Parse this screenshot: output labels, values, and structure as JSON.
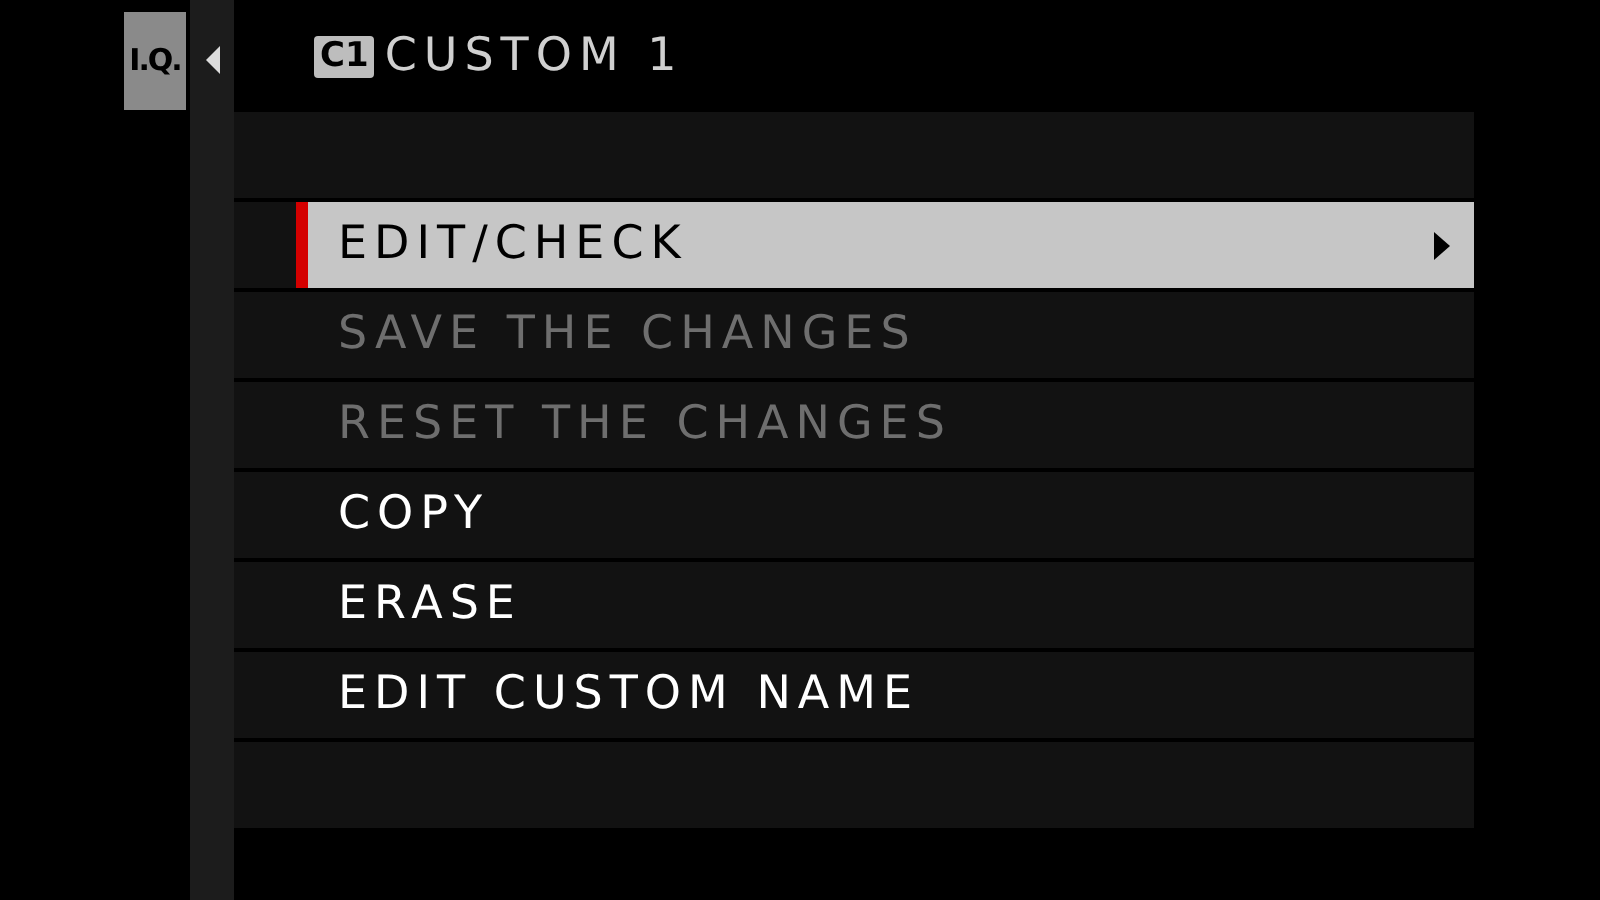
{
  "side_tab": {
    "label": "I.Q.",
    "selected": true
  },
  "header": {
    "badge": "C1",
    "title": "CUSTOM 1"
  },
  "menu": [
    {
      "label": "EDIT/CHECK",
      "selected": true,
      "disabled": false,
      "submenu": true
    },
    {
      "label": "SAVE THE CHANGES",
      "selected": false,
      "disabled": true,
      "submenu": false
    },
    {
      "label": "RESET THE CHANGES",
      "selected": false,
      "disabled": true,
      "submenu": false
    },
    {
      "label": "COPY",
      "selected": false,
      "disabled": false,
      "submenu": false
    },
    {
      "label": "ERASE",
      "selected": false,
      "disabled": false,
      "submenu": false
    },
    {
      "label": "EDIT CUSTOM NAME",
      "selected": false,
      "disabled": false,
      "submenu": false
    }
  ]
}
